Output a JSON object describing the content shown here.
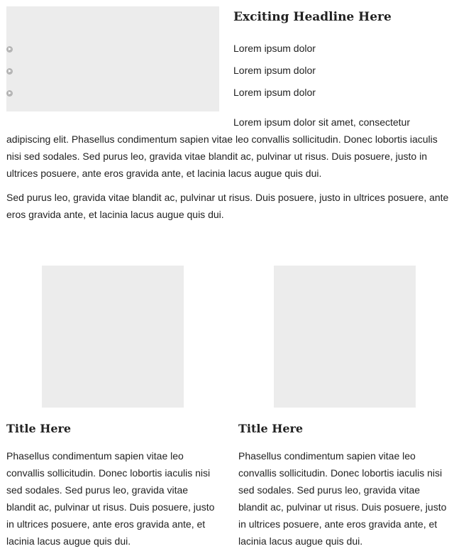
{
  "intro": {
    "headline": "Exciting Headline Here",
    "bullets": [
      "Lorem ipsum dolor",
      "Lorem ipsum dolor",
      "Lorem ipsum dolor"
    ],
    "paragraph1": "Lorem ipsum dolor sit amet, consectetur adipiscing elit. Phasellus condimentum sapien vitae leo convallis sollicitudin. Donec lobortis iaculis nisi sed sodales. Sed purus leo, gravida vitae blandit ac, pulvinar ut risus. Duis posuere, justo in ultrices posuere, ante eros gravida ante, et lacinia lacus augue quis dui.",
    "paragraph2": "Sed purus leo, gravida vitae blandit ac, pulvinar ut risus. Duis posuere, justo in ultrices posuere, ante eros gravida ante, et lacinia lacus augue quis dui."
  },
  "columns": [
    {
      "title": "Title Here",
      "text": "Phasellus condimentum sapien vitae leo convallis sollicitudin. Donec lobortis iaculis nisi sed sodales. Sed purus leo, gravida vitae blandit ac, pulvinar ut risus. Duis posuere, justo in ultrices posuere, ante eros gravida ante, et lacinia lacus augue quis dui."
    },
    {
      "title": "Title Here",
      "text": "Phasellus condimentum sapien vitae leo convallis sollicitudin. Donec lobortis iaculis nisi sed sodales. Sed purus leo, gravida vitae blandit ac, pulvinar ut risus. Duis posuere, justo in ultrices posuere, ante eros gravida ante, et lacinia lacus augue quis dui."
    }
  ],
  "colors": {
    "placeholder": "#ececec",
    "bullet": "#b5b5b5",
    "text": "#222222"
  },
  "icons": {
    "bullet": "play-circle-icon"
  }
}
